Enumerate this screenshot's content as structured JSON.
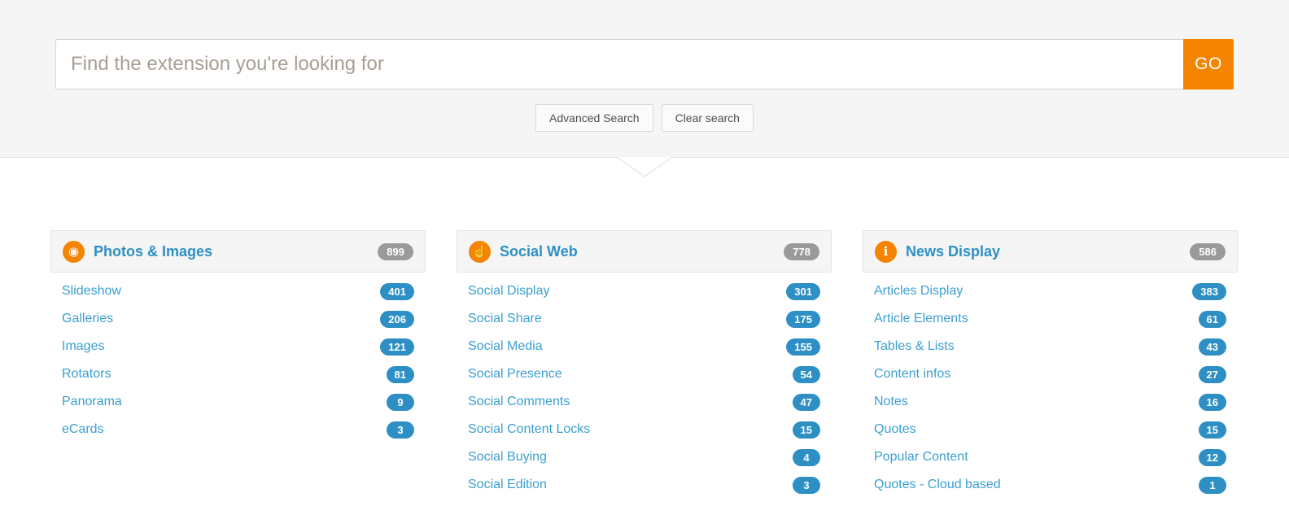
{
  "search": {
    "placeholder": "Find the extension you're looking for",
    "value": "",
    "go_label": "GO",
    "advanced_label": "Advanced Search",
    "clear_label": "Clear search"
  },
  "colors": {
    "accent": "#f58400",
    "link": "#3b9fd1",
    "badge_blue": "#2d8fc4",
    "badge_gray": "#9a9a9a"
  },
  "categories": [
    {
      "title": "Photos & Images",
      "count": "899",
      "icon": "camera-icon",
      "icon_glyph": "◉",
      "items": [
        {
          "label": "Slideshow",
          "count": "401"
        },
        {
          "label": "Galleries",
          "count": "206"
        },
        {
          "label": "Images",
          "count": "121"
        },
        {
          "label": "Rotators",
          "count": "81"
        },
        {
          "label": "Panorama",
          "count": "9"
        },
        {
          "label": "eCards",
          "count": "3"
        }
      ]
    },
    {
      "title": "Social Web",
      "count": "778",
      "icon": "thumbs-up-icon",
      "icon_glyph": "☝",
      "items": [
        {
          "label": "Social Display",
          "count": "301"
        },
        {
          "label": "Social Share",
          "count": "175"
        },
        {
          "label": "Social Media",
          "count": "155"
        },
        {
          "label": "Social Presence",
          "count": "54"
        },
        {
          "label": "Social Comments",
          "count": "47"
        },
        {
          "label": "Social Content Locks",
          "count": "15"
        },
        {
          "label": "Social Buying",
          "count": "4"
        },
        {
          "label": "Social Edition",
          "count": "3"
        }
      ]
    },
    {
      "title": "News Display",
      "count": "586",
      "icon": "info-icon",
      "icon_glyph": "ℹ",
      "items": [
        {
          "label": "Articles Display",
          "count": "383"
        },
        {
          "label": "Article Elements",
          "count": "61"
        },
        {
          "label": "Tables & Lists",
          "count": "43"
        },
        {
          "label": "Content infos",
          "count": "27"
        },
        {
          "label": "Notes",
          "count": "16"
        },
        {
          "label": "Quotes",
          "count": "15"
        },
        {
          "label": "Popular Content",
          "count": "12"
        },
        {
          "label": "Quotes - Cloud based",
          "count": "1"
        }
      ]
    }
  ]
}
